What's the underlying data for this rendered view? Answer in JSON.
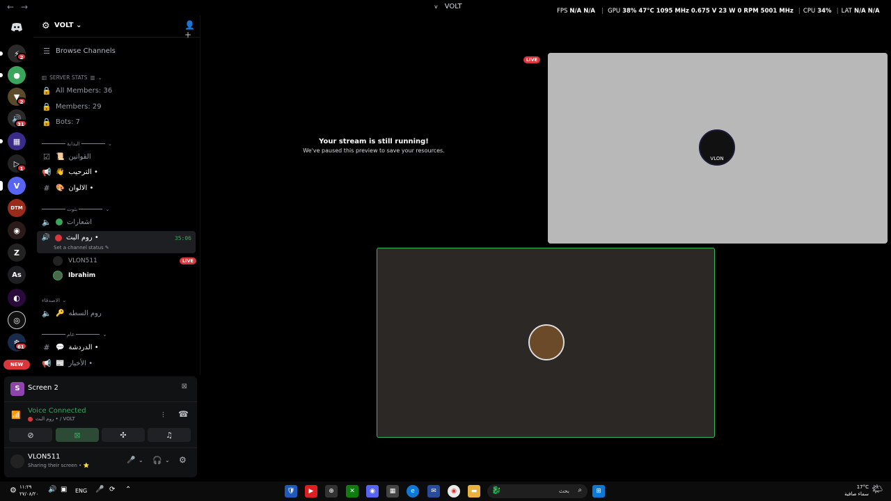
{
  "titlebar": {
    "back": "←",
    "forward": "→",
    "server_chevron": "v",
    "title": "VOLT",
    "overlay": [
      "FPS",
      "N/A",
      "N/A",
      "GPU",
      "38%",
      "47°C",
      "1095 MHz",
      "0.675",
      "V",
      "23 W",
      "0 RPM",
      "5001 MHz",
      "CPU",
      "34%",
      "LAT",
      "N/A",
      "N/A"
    ]
  },
  "rail": {
    "logo": "discord",
    "badges": [
      "2",
      "2",
      "31",
      "1",
      "61"
    ],
    "v_server": "V",
    "as_server": "As",
    "new_label": "NEW"
  },
  "sidebar": {
    "server_name": "VOLT",
    "browse": "Browse Channels",
    "stats_category": "SERVER STATS",
    "stats": [
      "All Members: 36",
      "Members: 29",
      "Bots: 7"
    ],
    "cat1": "البداية",
    "ch_rules": "القوانين",
    "ch_welcome": "الترحيب •",
    "ch_colors": "الالوان •",
    "cat2": "بثوت",
    "ch_voice1": "اشعارات",
    "ch_live": "روم البث •",
    "live_timer": "35:06",
    "set_status": "Set a channel status",
    "user1": "VLON511",
    "live_label": "LIVE",
    "user2": "Ibrahim",
    "cat3": "الاصدقاء",
    "ch_voice2": "روم السطه",
    "cat4": "عام",
    "ch_chat": "الدردشة •",
    "ch_news": "الأخبار •"
  },
  "panel": {
    "screen_label": "Screen 2",
    "voice_status": "Voice Connected",
    "voice_path": "روم البث • / VOLT",
    "username": "VLON511",
    "user_status": "Sharing their screen • ⭐"
  },
  "main": {
    "stream_title": "Your stream is still running!",
    "stream_sub": "We've paused this preview to save your resources.",
    "live_label": "LIVE",
    "avatar_label": "VLON"
  },
  "taskbar": {
    "time": "١١:٢٩",
    "date": "٢٧/٠٨/٢٠",
    "lang": "ENG",
    "search_placeholder": "بحث",
    "weather_temp": "17°C",
    "weather_desc": "سماء صافية"
  },
  "colors": {
    "accent_green": "#2fbf5a",
    "live_red": "#da373c",
    "discord_blurple": "#5865f2"
  }
}
